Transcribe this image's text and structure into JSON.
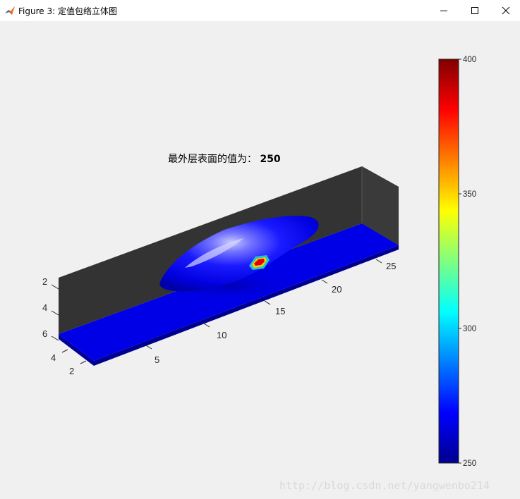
{
  "window": {
    "title": "Figure 3: 定值包络立体图",
    "controls": [
      "minimize",
      "maximize",
      "close"
    ],
    "icon": "matlab-icon"
  },
  "plot": {
    "title_prefix": "最外层表面的值为：",
    "title_value": "250",
    "x_ticks": [
      "5",
      "10",
      "15",
      "20",
      "25"
    ],
    "y_ticks": [
      "2",
      "4"
    ],
    "z_ticks": [
      "2",
      "4",
      "6"
    ]
  },
  "colorbar": {
    "ticks": [
      "400",
      "350",
      "300",
      "250"
    ],
    "range": [
      250,
      400
    ],
    "colormap": "jet"
  },
  "colors": {
    "wall": "#333333",
    "floor": "#0000e6",
    "surface": "#0000ff",
    "background": "#f0f0f0"
  },
  "watermark": "http://blog.csdn.net/yangwenbo214"
}
